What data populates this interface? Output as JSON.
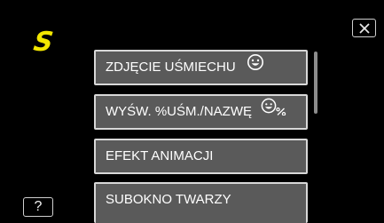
{
  "header": {
    "logo_text": "S",
    "logo_color": "#f2e600"
  },
  "controls": {
    "close_icon": "close-icon",
    "help_label": "?"
  },
  "menu": {
    "items": [
      {
        "label": "ZDJĘCIE UŚMIECHU",
        "icon": "smile-face-icon"
      },
      {
        "label": "WYŚW. %UŚM./NAZWĘ",
        "icon": "smile-face-percent-icon"
      },
      {
        "label": "EFEKT ANIMACJI"
      },
      {
        "label": "SUBOKNO TWARZY"
      }
    ]
  }
}
